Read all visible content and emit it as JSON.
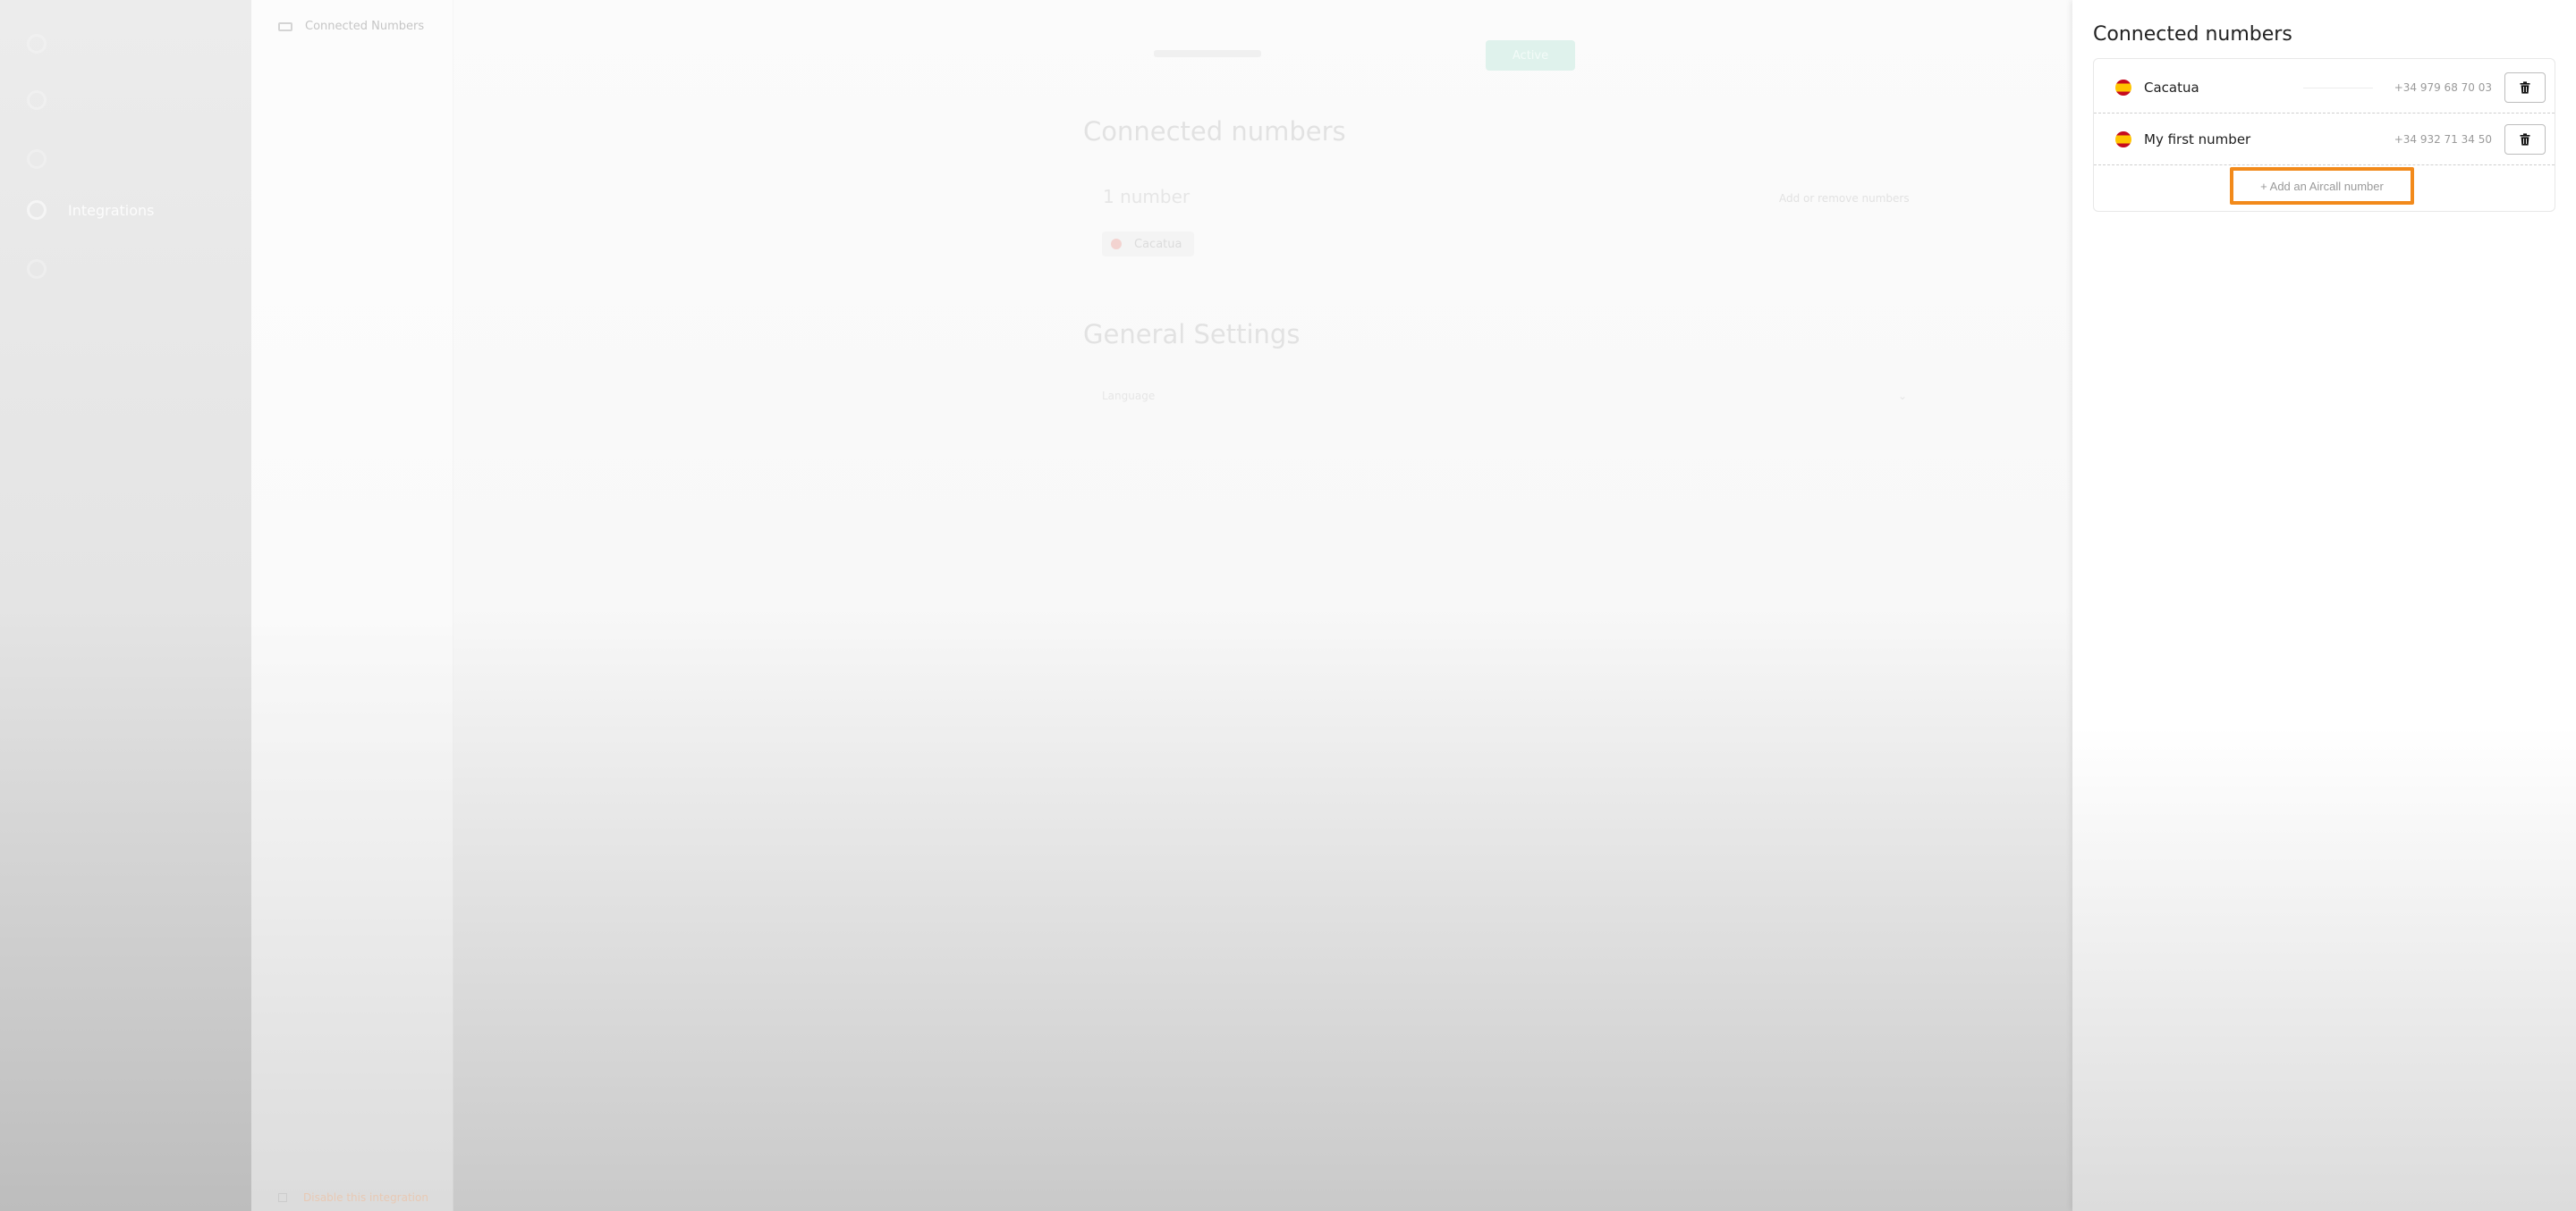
{
  "sidebar": {
    "items": [
      {
        "label": ""
      },
      {
        "label": ""
      },
      {
        "label": "Integrations"
      },
      {
        "label": ""
      }
    ]
  },
  "main": {
    "subnav": {
      "item_label": "Connected Numbers"
    },
    "status_button": "Active",
    "connected_title": "Connected numbers",
    "count_text": "1 number",
    "manage_link": "Add or remove numbers",
    "chip_label": "Cacatua",
    "general_title": "General Settings",
    "setting_label": "Language",
    "bottom_link": "Disable this integration"
  },
  "panel": {
    "title": "Connected numbers",
    "numbers": [
      {
        "name": "Cacatua",
        "phone": "+34 979 68 70 03"
      },
      {
        "name": "My first number",
        "phone": "+34 932 71 34 50"
      }
    ],
    "add_button": "+ Add an Aircall number"
  },
  "colors": {
    "accent_highlight": "#f28a1b",
    "flag_red": "#c60b1e",
    "flag_yellow": "#ffc400"
  }
}
